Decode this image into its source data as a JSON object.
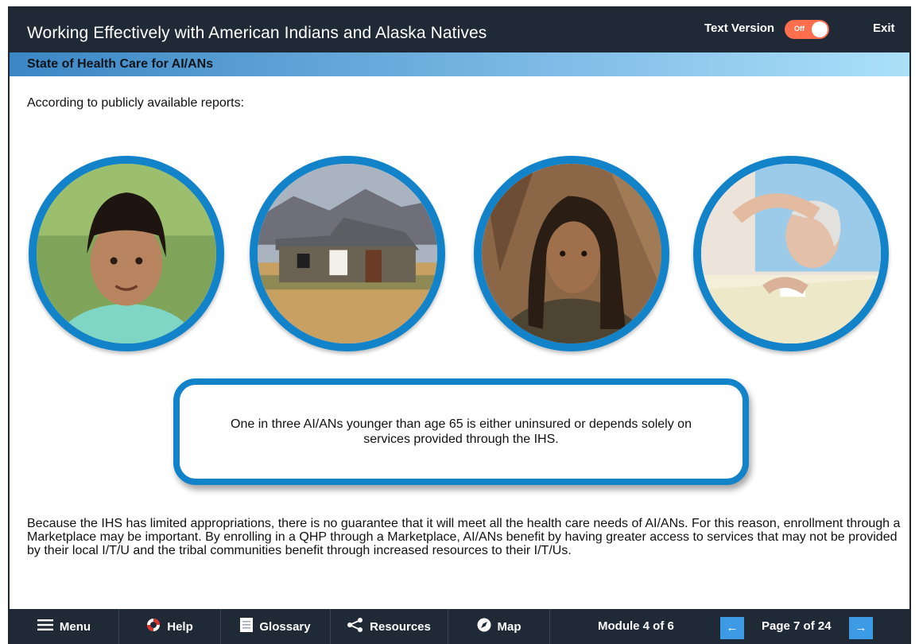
{
  "header": {
    "app_title": "Working Effectively with American Indians and Alaska Natives",
    "text_version_label": "Text Version",
    "toggle_state": "Off",
    "exit_label": "Exit"
  },
  "section": {
    "title": "State of Health Care for AI/ANs"
  },
  "content": {
    "intro": "According to publicly available reports:",
    "photos": [
      "child-portrait",
      "rural-house",
      "young-man-portrait",
      "elderly-woman-in-bed"
    ],
    "callout": "One in three AI/ANs younger than age 65 is either uninsured or depends solely on services provided through the IHS.",
    "body": "Because the IHS has limited appropriations, there is no guarantee that it will meet all the health care needs of AI/ANs. For this reason, enrollment through a Marketplace may be important. By enrolling in a QHP through a Marketplace, AI/ANs benefit by having greater access to services that may not be provided by their local I/T/U and the tribal communities benefit through increased resources to their I/T/Us."
  },
  "footer": {
    "menu_label": "Menu",
    "help_label": "Help",
    "glossary_label": "Glossary",
    "resources_label": "Resources",
    "map_label": "Map",
    "module_label": "Module 4 of 6",
    "page_label": "Page 7 of 24"
  },
  "colors": {
    "topbar": "#1f2a36",
    "accent_blue": "#1383c9",
    "toggle_off": "#ff6f4e",
    "arrow_blue": "#3d9be5"
  }
}
